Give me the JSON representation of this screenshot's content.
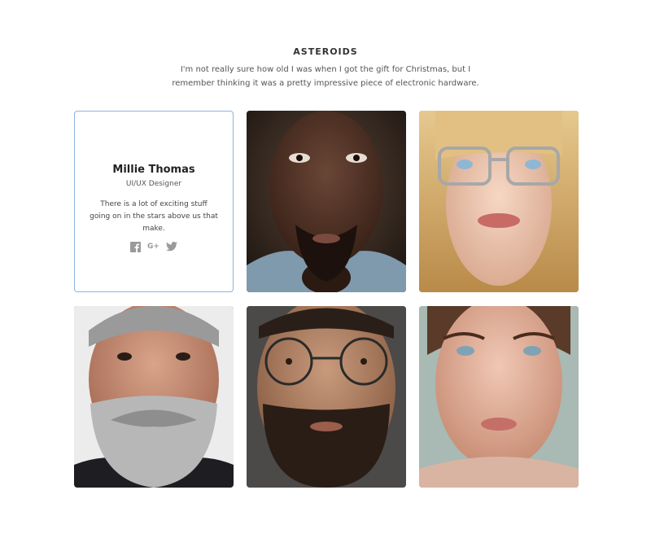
{
  "section": {
    "title": "ASTEROIDS",
    "description": "I'm not really sure how old I was when I got the gift for Christmas, but I remember thinking it was a pretty impressive piece of electronic hardware."
  },
  "profile": {
    "name": "Millie Thomas",
    "role": "UI/UX Designer",
    "bio": "There is a lot of exciting stuff going on in the stars above us that make.",
    "socials": [
      {
        "icon": "facebook-icon",
        "label": ""
      },
      {
        "icon": "google-plus-icon",
        "label": "G+"
      },
      {
        "icon": "twitter-icon",
        "label": ""
      }
    ]
  },
  "colors": {
    "card_border": "#8fb3e0",
    "social_icon": "#9a9a9a"
  },
  "photos": [
    {
      "name": "portrait-man-dark-skin",
      "subject": "man"
    },
    {
      "name": "portrait-woman-glasses-blonde",
      "subject": "woman"
    },
    {
      "name": "portrait-man-gray-beard",
      "subject": "man"
    },
    {
      "name": "portrait-man-round-glasses",
      "subject": "man"
    },
    {
      "name": "portrait-woman-freckles",
      "subject": "woman"
    }
  ]
}
